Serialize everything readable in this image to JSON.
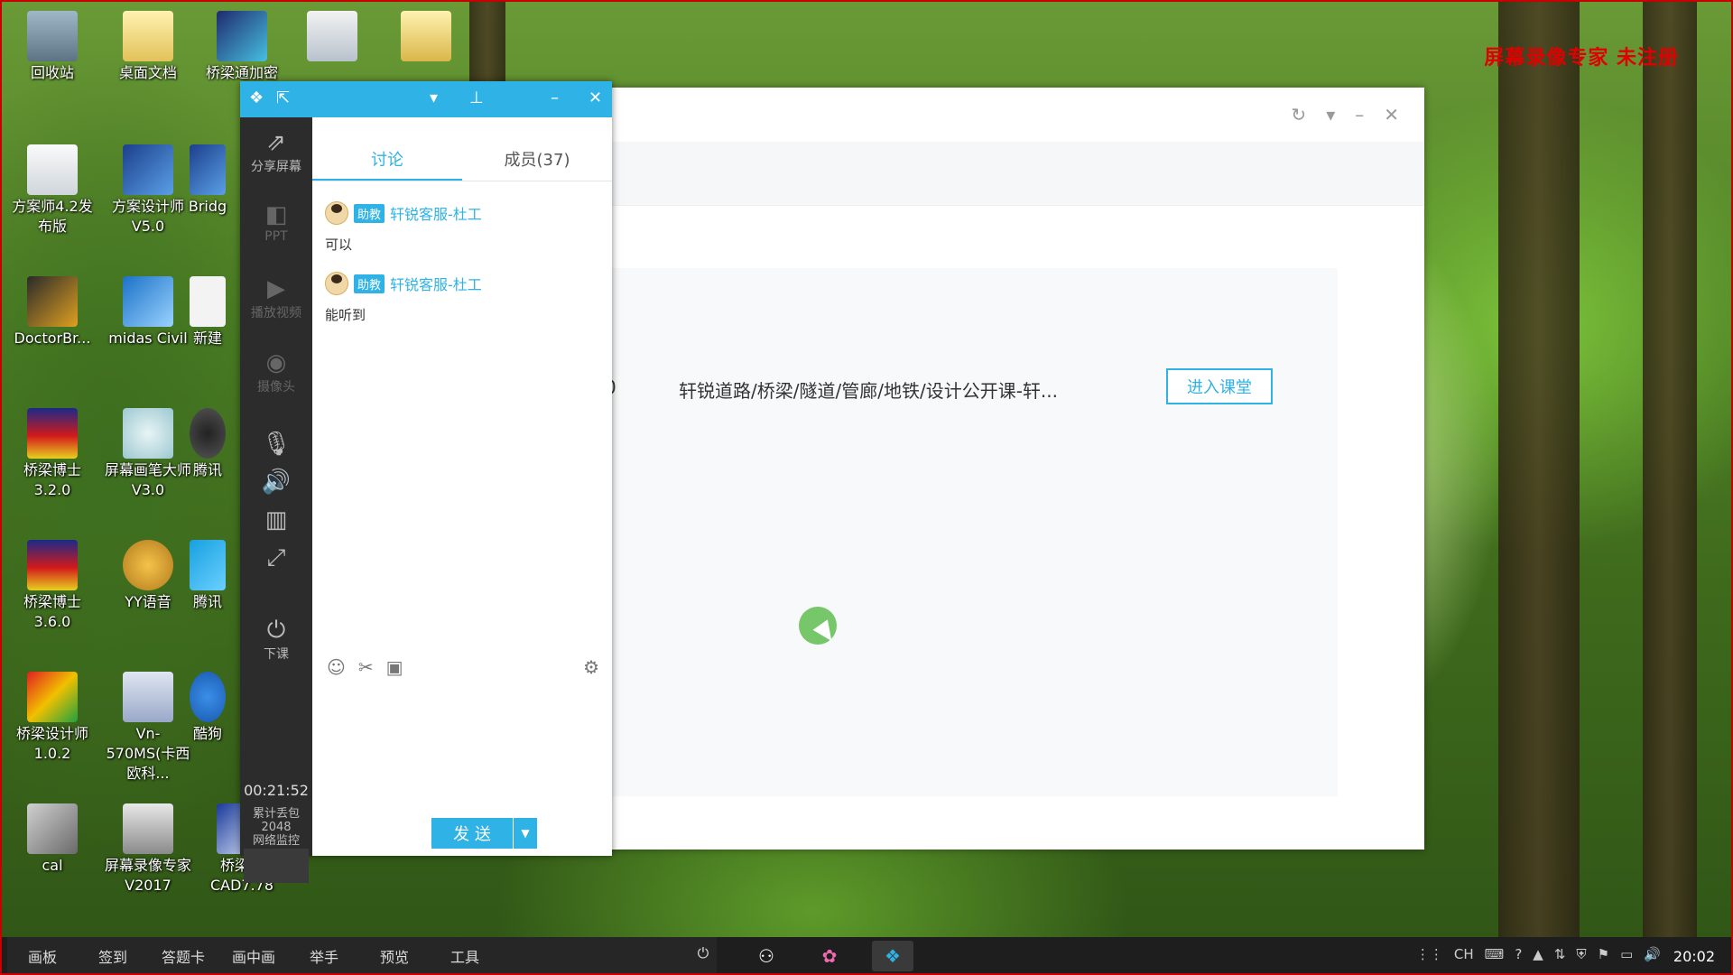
{
  "watermark": "屏幕录像专家 未注册",
  "desktop_icons": [
    {
      "label": "回收站"
    },
    {
      "label": "桌面文档"
    },
    {
      "label": "桥梁通加密"
    },
    {
      "label": ""
    },
    {
      "label": ""
    },
    {
      "label": "方案师4.2发布版"
    },
    {
      "label": "方案设计师V5.0"
    },
    {
      "label": "Bridg"
    },
    {
      "label": "DoctorBr..."
    },
    {
      "label": "midas Civil"
    },
    {
      "label": "新建"
    },
    {
      "label": "桥梁博士3.2.0"
    },
    {
      "label": "屏幕画笔大师 V3.0"
    },
    {
      "label": "腾讯"
    },
    {
      "label": "桥梁博士3.6.0"
    },
    {
      "label": "YY语音"
    },
    {
      "label": "腾讯"
    },
    {
      "label": "桥梁设计师1.0.2"
    },
    {
      "label": "Vn-570MS(卡西欧科..."
    },
    {
      "label": "酷狗"
    },
    {
      "label": "cal"
    },
    {
      "label": "屏幕录像专家V2017"
    },
    {
      "label": "桥梁通CAD7.78"
    }
  ],
  "main_window": {
    "course_index": "0",
    "course_title": "轩锐道路/桥梁/隧道/管廊/地铁/设计公开课-轩...",
    "enter_button": "进入课堂"
  },
  "classroom": {
    "sidebar": {
      "share_screen": "分享屏幕",
      "ppt": "PPT",
      "play_video": "播放视频",
      "camera": "摄像头",
      "end_class": "下课",
      "timer": "00:21:52",
      "loss_label": "累计丢包",
      "loss_value": "2048",
      "network_monitor": "网络监控"
    },
    "tabs": {
      "discussion": "讨论",
      "members": "成员(37)"
    },
    "messages": [
      {
        "role": "助教",
        "user": "轩锐客服-杜工",
        "text": "可以"
      },
      {
        "role": "助教",
        "user": "轩锐客服-杜工",
        "text": "能听到"
      }
    ],
    "send_button": "发 送"
  },
  "taskbar": {
    "tools": [
      "画板",
      "签到",
      "答题卡",
      "画中画",
      "举手",
      "预览",
      "工具"
    ],
    "ime": "CH",
    "clock": "20:02"
  },
  "colors": {
    "accent": "#2fb2e6",
    "watermark": "#e10000",
    "sidebar_bg": "#2c2c2c"
  }
}
